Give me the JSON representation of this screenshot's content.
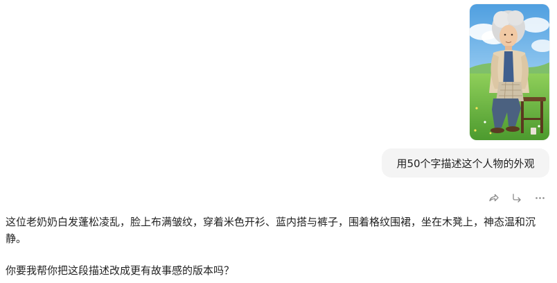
{
  "user_message": {
    "image_description_icon": "elderly-woman-sitting-on-stool-in-meadow",
    "text": "用50个字描述这个人物的外观"
  },
  "message_actions": [
    {
      "icon": "share-icon"
    },
    {
      "icon": "reply-icon"
    },
    {
      "icon": "more-icon"
    }
  ],
  "assistant_message": {
    "paragraph_1": "这位老奶奶白发蓬松凌乱，脸上布满皱纹，穿着米色开衫、蓝内搭与裤子，围着格纹围裙，坐在木凳上，神态温和沉静。",
    "paragraph_2": "你要我帮你把这段描述改成更有故事感的版本吗？"
  },
  "colors": {
    "bubble_bg": "#f4f4f4",
    "icon": "#8a8a8a",
    "text": "#222222"
  }
}
